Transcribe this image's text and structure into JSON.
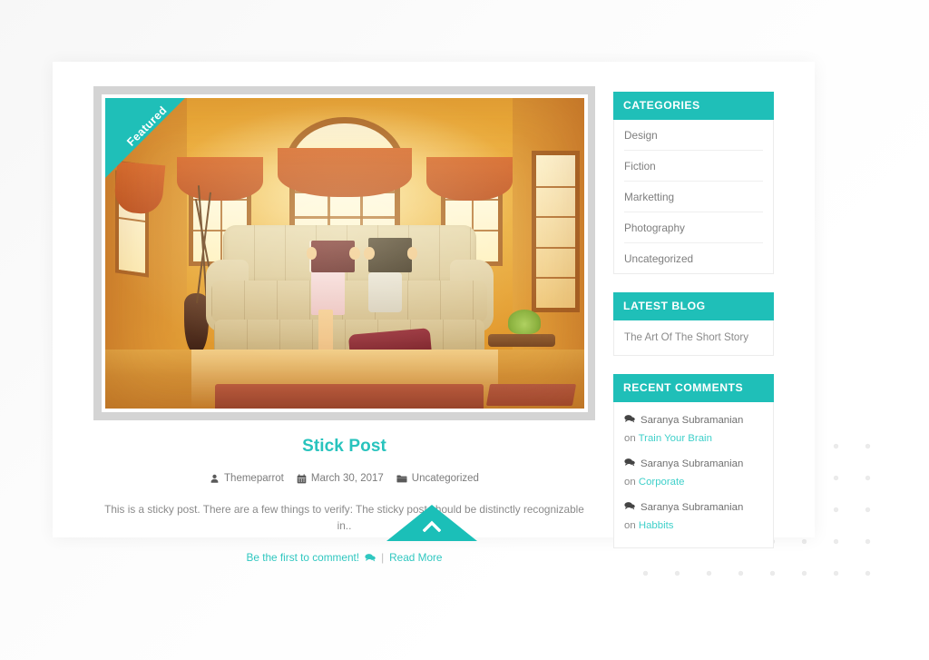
{
  "theme": {
    "accent": "#1fbfb8",
    "accent_light": "#3fd0ca",
    "title_color": "#28c3bd",
    "body_text": "#8a8a8a",
    "card_bg": "#ffffff",
    "page_bg": "#fdfdfd",
    "frame_border": "#d4d4d4",
    "dot_color": "#ebebeb"
  },
  "post": {
    "ribbon_label": "Featured",
    "title": "Stick Post",
    "image_alt": "Two people reading books on a floral sofa in a sunlit living room",
    "meta": {
      "author_icon": "user-icon",
      "author": "Themeparrot",
      "date_icon": "calendar-icon",
      "date": "March 30, 2017",
      "category_icon": "folder-icon",
      "category": "Uncategorized"
    },
    "excerpt": "This is a sticky post. There are a few things to verify: The sticky post should be distinctly recognizable in..",
    "actions": {
      "comment_label": "Be the first to comment!",
      "comment_icon": "comment-icon",
      "separator": "|",
      "read_more_label": "Read More"
    }
  },
  "sidebar": {
    "widgets": [
      {
        "id": "categories",
        "title": "CATEGORIES",
        "items": [
          {
            "label": "Design"
          },
          {
            "label": "Fiction"
          },
          {
            "label": "Marketting"
          },
          {
            "label": "Photography"
          },
          {
            "label": "Uncategorized"
          }
        ]
      },
      {
        "id": "latest-blog",
        "title": "LATEST BLOG",
        "items": [
          {
            "label": "The Art Of The Short Story"
          }
        ]
      },
      {
        "id": "recent-comments",
        "title": "RECENT COMMENTS",
        "comments": [
          {
            "icon": "comment-icon",
            "author": "Saranya Subramanian",
            "on_label": "on",
            "post": "Train Your Brain"
          },
          {
            "icon": "comment-icon",
            "author": "Saranya Subramanian",
            "on_label": "on",
            "post": "Corporate"
          },
          {
            "icon": "comment-icon",
            "author": "Saranya Subramanian",
            "on_label": "on",
            "post": "Habbits"
          }
        ]
      }
    ]
  },
  "scroll_top": {
    "icon": "chevron-up-icon",
    "label": "Back to top"
  }
}
